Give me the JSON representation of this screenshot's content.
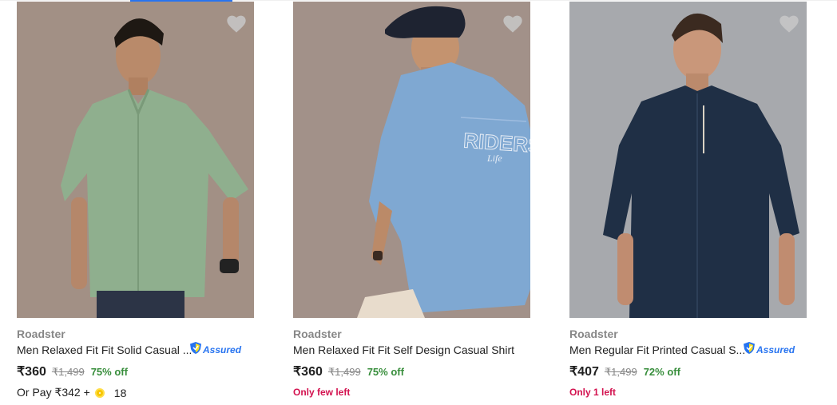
{
  "products": [
    {
      "brand": "Roadster",
      "title": "Men Relaxed Fit Fit Solid Casual ...",
      "assured_label": "Assured",
      "price": "₹360",
      "mrp": "₹1,499",
      "discount": "75% off",
      "extra_offer": {
        "prefix": "Or Pay ₹342 +",
        "coins": "18"
      },
      "shirt_color": "#8faf8e"
    },
    {
      "brand": "Roadster",
      "title": "Men Relaxed Fit Fit Self Design Casual Shirt",
      "price": "₹360",
      "mrp": "₹1,499",
      "discount": "75% off",
      "stock": "Only few left",
      "shirt_color": "#7fa8d2"
    },
    {
      "brand": "Roadster",
      "title": "Men Regular Fit Printed Casual S...",
      "assured_label": "Assured",
      "price": "₹407",
      "mrp": "₹1,499",
      "discount": "72% off",
      "stock": "Only 1 left",
      "shirt_color": "#1f2f45"
    }
  ],
  "colors": {
    "accent": "#2874f0",
    "discount_green": "#388e3c",
    "stock_red": "#d3124f",
    "muted": "#878787"
  }
}
